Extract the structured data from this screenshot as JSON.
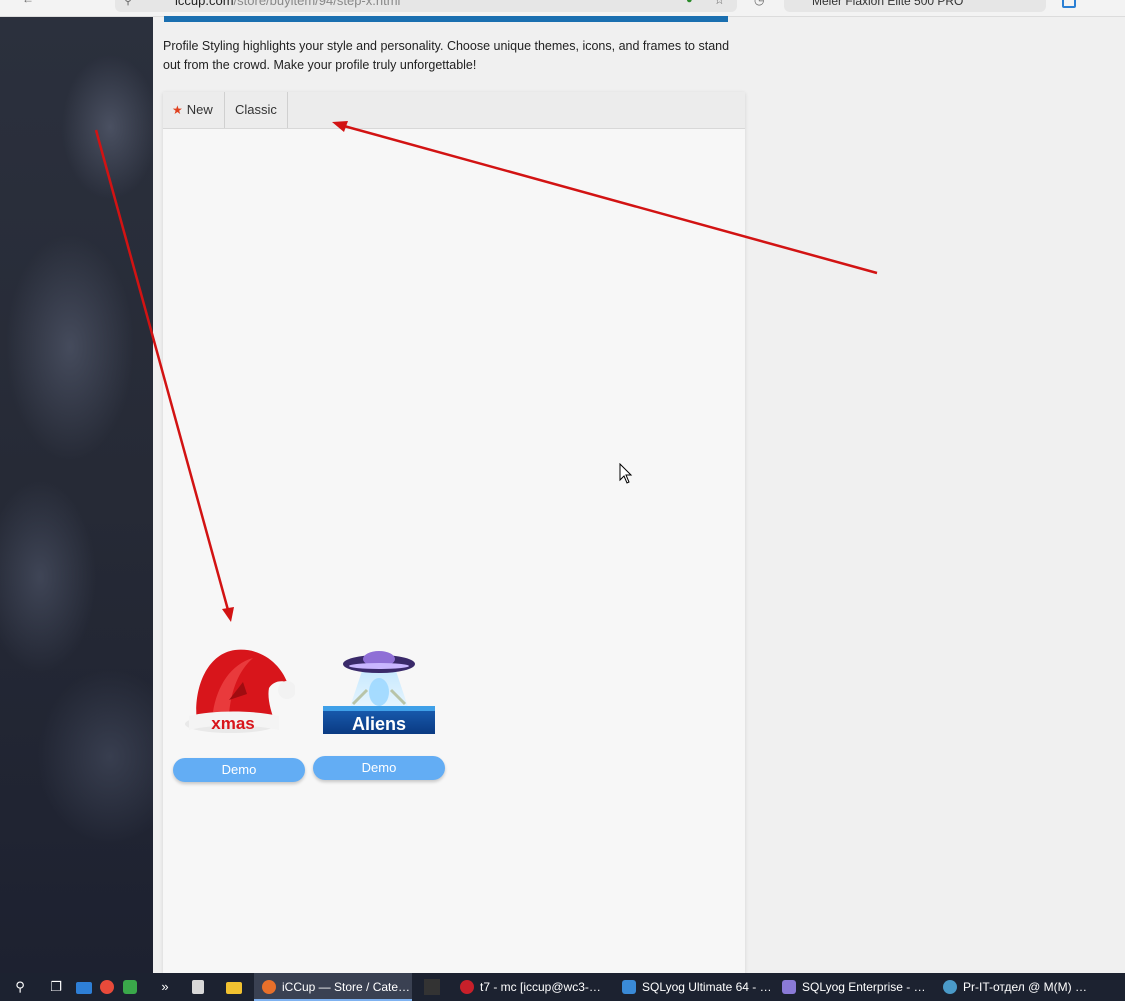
{
  "browser": {
    "url_host": "iccup.com",
    "url_path": "/store/buyitem/94/step-x.html",
    "side_tab_title": "Meier Flaxion Elite 500 PRO"
  },
  "page": {
    "intro_text": "Profile Styling highlights your style and personality. Choose unique themes, icons, and frames to stand out from the crowd. Make your profile truly unforgettable!",
    "tabs": [
      {
        "label": "New",
        "icon": "star-icon"
      },
      {
        "label": "Classic"
      }
    ],
    "items": [
      {
        "name": "xmas",
        "caption": "xmas",
        "button_label": "Demo"
      },
      {
        "name": "aliens",
        "caption": "Aliens",
        "button_label": "Demo"
      }
    ]
  },
  "annotations": {
    "arrow_color": "#d21313"
  },
  "taskbar": {
    "tasks": [
      {
        "label": "iCCup — Store / Cate…",
        "icon": "firefox-icon",
        "active": true
      },
      {
        "label": "t7 - mc [iccup@wc3-…",
        "icon": "terminal-icon"
      },
      {
        "label": "SQLyog Ultimate 64 - …",
        "icon": "sqlyog-icon"
      },
      {
        "label": "SQLyog Enterprise - …",
        "icon": "sqlyog-enterprise-icon"
      },
      {
        "label": "Pr-IT-отдел @ M(M) …",
        "icon": "chat-icon"
      }
    ]
  }
}
